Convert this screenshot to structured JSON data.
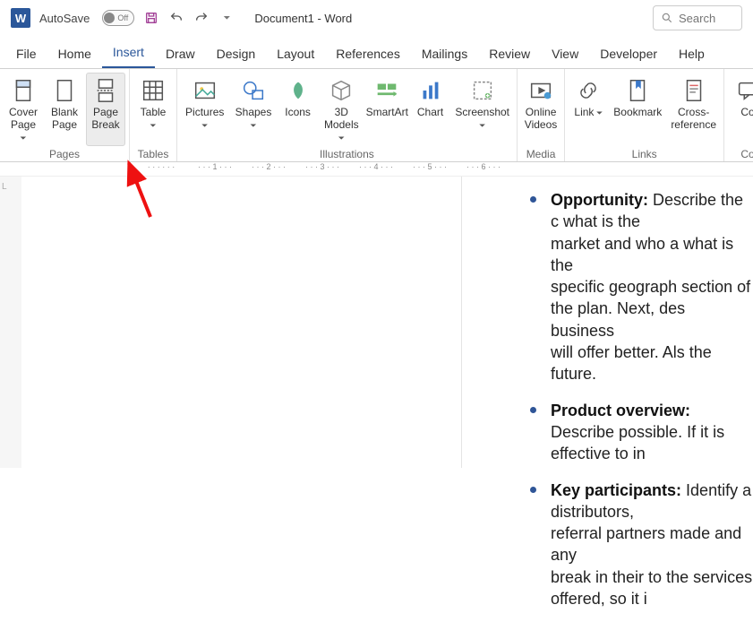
{
  "titlebar": {
    "autosave_label": "AutoSave",
    "autosave_state": "Off",
    "doc_title": "Document1 - Word",
    "search_placeholder": "Search"
  },
  "tabs": {
    "items": [
      {
        "label": "File"
      },
      {
        "label": "Home"
      },
      {
        "label": "Insert"
      },
      {
        "label": "Draw"
      },
      {
        "label": "Design"
      },
      {
        "label": "Layout"
      },
      {
        "label": "References"
      },
      {
        "label": "Mailings"
      },
      {
        "label": "Review"
      },
      {
        "label": "View"
      },
      {
        "label": "Developer"
      },
      {
        "label": "Help"
      }
    ],
    "active_index": 2
  },
  "ribbon": {
    "groups": [
      {
        "label": "Pages",
        "items": [
          {
            "label": "Cover\nPage",
            "dd": true,
            "name": "cover-page-button"
          },
          {
            "label": "Blank\nPage",
            "dd": false,
            "name": "blank-page-button"
          },
          {
            "label": "Page\nBreak",
            "dd": false,
            "name": "page-break-button",
            "selected": true
          }
        ]
      },
      {
        "label": "Tables",
        "items": [
          {
            "label": "Table",
            "dd": true,
            "name": "table-button"
          }
        ]
      },
      {
        "label": "Illustrations",
        "items": [
          {
            "label": "Pictures",
            "dd": true,
            "name": "pictures-button"
          },
          {
            "label": "Shapes",
            "dd": true,
            "name": "shapes-button"
          },
          {
            "label": "Icons",
            "dd": false,
            "name": "icons-button"
          },
          {
            "label": "3D\nModels",
            "dd": true,
            "name": "3d-models-button"
          },
          {
            "label": "SmartArt",
            "dd": false,
            "name": "smartart-button"
          },
          {
            "label": "Chart",
            "dd": false,
            "name": "chart-button"
          },
          {
            "label": "Screenshot",
            "dd": true,
            "name": "screenshot-button"
          }
        ]
      },
      {
        "label": "Media",
        "items": [
          {
            "label": "Online\nVideos",
            "dd": false,
            "name": "online-videos-button"
          }
        ]
      },
      {
        "label": "Links",
        "items": [
          {
            "label": "Link",
            "dd": true,
            "name": "link-button"
          },
          {
            "label": "Bookmark",
            "dd": false,
            "name": "bookmark-button"
          },
          {
            "label": "Cross-\nreference",
            "dd": false,
            "name": "cross-reference-button"
          }
        ]
      },
      {
        "label": "Co",
        "items": [
          {
            "label": "Co",
            "dd": false,
            "name": "comment-button"
          }
        ]
      }
    ]
  },
  "ruler": {
    "ticks": [
      "",
      "1",
      "2",
      "3",
      "4",
      "5",
      "6"
    ]
  },
  "document": {
    "bullets": [
      {
        "heading": "Opportunity:",
        "body": "Describe the c what is the market and who a what is the specific geograph section of the plan. Next, des business will offer better. Als the future."
      },
      {
        "heading": "Product overview:",
        "body": "Describe possible. If it is effective to in"
      },
      {
        "heading": "Key participants:",
        "body": "Identify a distributors, referral partners made and any break in their to the services offered, so it i"
      }
    ]
  }
}
